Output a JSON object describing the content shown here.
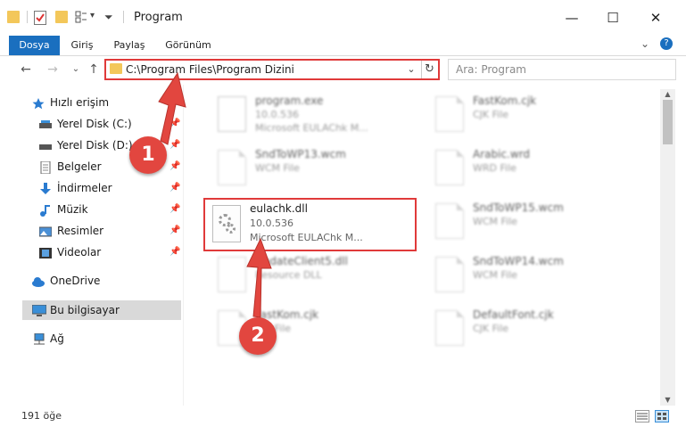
{
  "window": {
    "title": "Program",
    "controls": {
      "minimize": "—",
      "maximize": "☐",
      "close": "✕"
    }
  },
  "ribbon": {
    "tabs": [
      "Dosya",
      "Giriş",
      "Paylaş",
      "Görünüm"
    ],
    "collapse": "⌄",
    "help": "?"
  },
  "nav": {
    "back": "←",
    "forward": "→",
    "recent": "⌄",
    "up": "↑",
    "address": "C:\\Program Files\\Program Dizini",
    "address_dropdown": "⌄",
    "refresh": "↻",
    "search_placeholder": "Ara: Program"
  },
  "sidebar": {
    "quick_access": "Hızlı erişim",
    "items": [
      {
        "label": "Yerel Disk (C:)",
        "icon": "drive-icon",
        "pin": "📌"
      },
      {
        "label": "Yerel Disk (D:)",
        "icon": "drive-icon",
        "pin": "📌"
      },
      {
        "label": "Belgeler",
        "icon": "documents-icon",
        "pin": "📌"
      },
      {
        "label": "İndirmeler",
        "icon": "download-icon",
        "pin": "📌"
      },
      {
        "label": "Müzik",
        "icon": "music-icon",
        "pin": "📌"
      },
      {
        "label": "Resimler",
        "icon": "pictures-icon",
        "pin": "📌"
      },
      {
        "label": "Videolar",
        "icon": "videos-icon",
        "pin": "📌"
      }
    ],
    "onedrive": "OneDrive",
    "this_pc": "Bu bilgisayar",
    "network": "Ağ"
  },
  "files": {
    "left": [
      {
        "name": "program.exe",
        "line2": "10.0.536",
        "line3": "Microsoft EULAChk M..."
      },
      {
        "name": "SndToWP13.wcm",
        "line2": "WCM File",
        "line3": ""
      },
      {
        "name": "",
        "line2": "",
        "line3": ""
      },
      {
        "name": "UpdateClient5.dll",
        "line2": "Resource DLL",
        "line3": ""
      },
      {
        "name": "FastKom.cjk",
        "line2": "CJK File",
        "line3": ""
      }
    ],
    "right": [
      {
        "name": "FastKom.cjk",
        "line2": "CJK File",
        "line3": ""
      },
      {
        "name": "Arabic.wrd",
        "line2": "WRD File",
        "line3": ""
      },
      {
        "name": "SndToWP15.wcm",
        "line2": "WCM File",
        "line3": ""
      },
      {
        "name": "SndToWP14.wcm",
        "line2": "WCM File",
        "line3": ""
      },
      {
        "name": "DefaultFont.cjk",
        "line2": "CJK File",
        "line3": ""
      }
    ],
    "highlighted": {
      "name": "eulachk.dll",
      "version": "10.0.536",
      "description": "Microsoft EULAChk M..."
    }
  },
  "annotations": {
    "step1": "1",
    "step2": "2"
  },
  "status": {
    "count": "191 öğe"
  },
  "colors": {
    "accent": "#1a6fbf",
    "highlight": "#e03a3a",
    "badge": "#e2463f",
    "folder": "#f3c75a"
  }
}
